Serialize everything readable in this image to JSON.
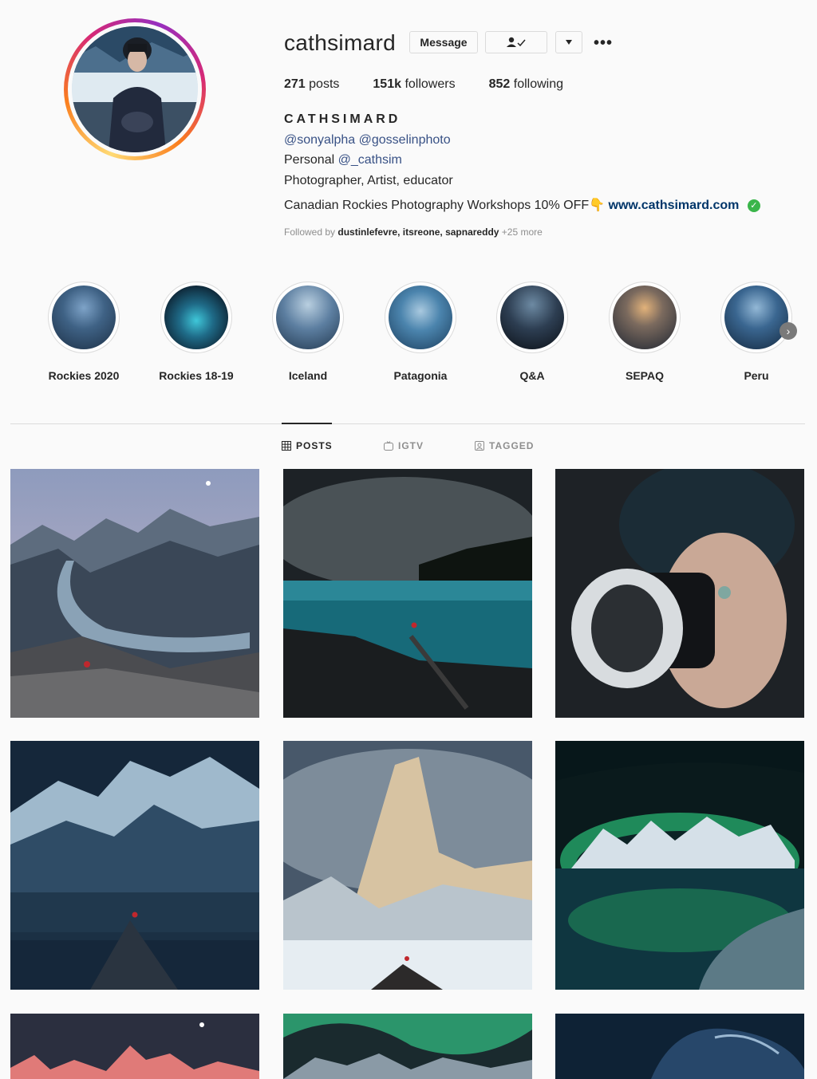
{
  "profile": {
    "username": "cathsimard",
    "message_label": "Message",
    "follow_status_icon": "person-check-icon",
    "dropdown_icon": "triangle-down-icon",
    "more_label": "•••",
    "stats": {
      "posts_count": "271",
      "posts_label": "posts",
      "followers_count": "151k",
      "followers_label": "followers",
      "following_count": "852",
      "following_label": "following"
    },
    "full_name": "CATHSIMARD",
    "bio": {
      "mentions": "@sonyalpha @gosselinphoto",
      "personal_prefix": "Personal",
      "personal_handle": "@_cathsim",
      "line3": "Photographer, Artist, educator",
      "line4": "Canadian Rockies Photography Workshops 10% OFF",
      "pointer_emoji": "👇",
      "website": "www.cathsimard.com",
      "verified_glyph": "✓"
    },
    "followed_by": {
      "prefix": "Followed by",
      "names": "dustinlefevre, itsreone, sapnareddy",
      "more": "+25 more"
    }
  },
  "highlights": [
    {
      "label": "Rockies 2020"
    },
    {
      "label": "Rockies 18-19"
    },
    {
      "label": "Iceland"
    },
    {
      "label": "Patagonia"
    },
    {
      "label": "Q&A"
    },
    {
      "label": "SEPAQ"
    },
    {
      "label": "Peru"
    }
  ],
  "tabs": {
    "posts": "POSTS",
    "igtv": "IGTV",
    "tagged": "TAGGED",
    "active": "posts"
  },
  "colors": {
    "link": "#385185",
    "website": "#003569",
    "verified": "#3ab54a",
    "text": "#262626",
    "muted": "#8e8e8e"
  }
}
